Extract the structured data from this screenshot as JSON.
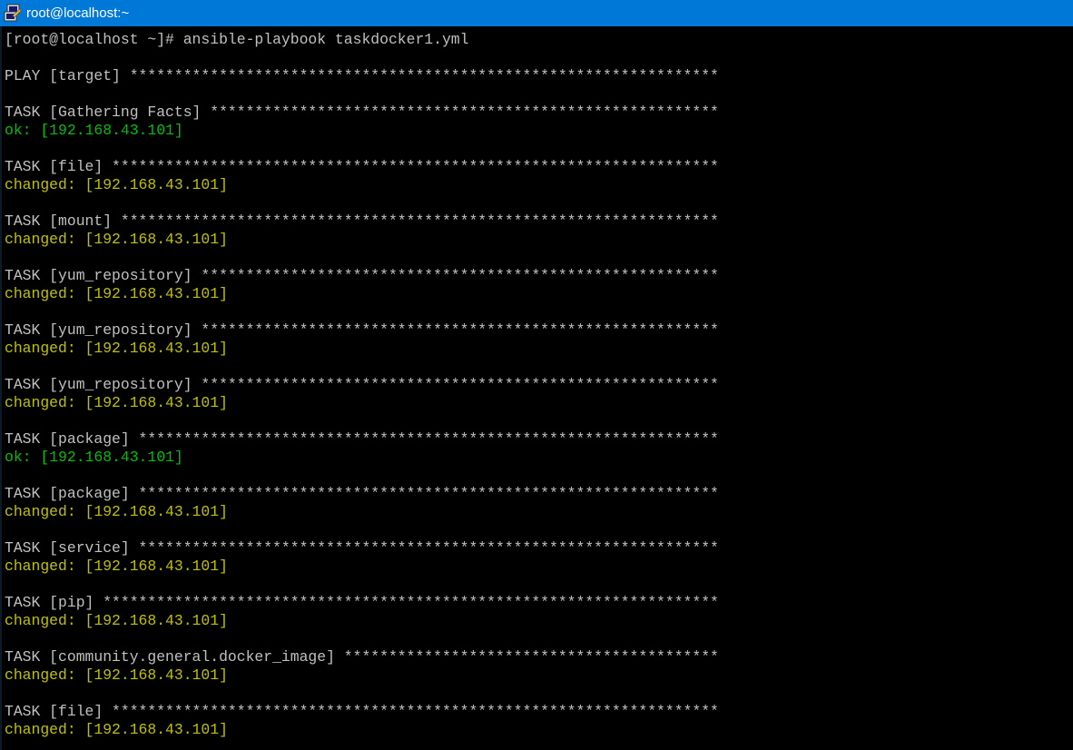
{
  "window": {
    "title": "root@localhost:~",
    "icon": "putty-icon"
  },
  "colors": {
    "titlebar": "#0078d7",
    "background": "#000000",
    "default_text": "#c0c0c0",
    "ok": "#00c000",
    "changed": "#c0c000"
  },
  "terminal": {
    "lines": [
      {
        "text": "[root@localhost ~]# ansible-playbook taskdocker1.yml",
        "style": "default"
      },
      {
        "text": "",
        "style": "default"
      },
      {
        "text": "PLAY [target] ******************************************************************",
        "style": "default"
      },
      {
        "text": "",
        "style": "default"
      },
      {
        "text": "TASK [Gathering Facts] *********************************************************",
        "style": "default"
      },
      {
        "text": "ok: [192.168.43.101]",
        "style": "green"
      },
      {
        "text": "",
        "style": "default"
      },
      {
        "text": "TASK [file] ********************************************************************",
        "style": "default"
      },
      {
        "text": "changed: [192.168.43.101]",
        "style": "yellow"
      },
      {
        "text": "",
        "style": "default"
      },
      {
        "text": "TASK [mount] *******************************************************************",
        "style": "default"
      },
      {
        "text": "changed: [192.168.43.101]",
        "style": "yellow"
      },
      {
        "text": "",
        "style": "default"
      },
      {
        "text": "TASK [yum_repository] **********************************************************",
        "style": "default"
      },
      {
        "text": "changed: [192.168.43.101]",
        "style": "yellow"
      },
      {
        "text": "",
        "style": "default"
      },
      {
        "text": "TASK [yum_repository] **********************************************************",
        "style": "default"
      },
      {
        "text": "changed: [192.168.43.101]",
        "style": "yellow"
      },
      {
        "text": "",
        "style": "default"
      },
      {
        "text": "TASK [yum_repository] **********************************************************",
        "style": "default"
      },
      {
        "text": "changed: [192.168.43.101]",
        "style": "yellow"
      },
      {
        "text": "",
        "style": "default"
      },
      {
        "text": "TASK [package] *****************************************************************",
        "style": "default"
      },
      {
        "text": "ok: [192.168.43.101]",
        "style": "green"
      },
      {
        "text": "",
        "style": "default"
      },
      {
        "text": "TASK [package] *****************************************************************",
        "style": "default"
      },
      {
        "text": "changed: [192.168.43.101]",
        "style": "yellow"
      },
      {
        "text": "",
        "style": "default"
      },
      {
        "text": "TASK [service] *****************************************************************",
        "style": "default"
      },
      {
        "text": "changed: [192.168.43.101]",
        "style": "yellow"
      },
      {
        "text": "",
        "style": "default"
      },
      {
        "text": "TASK [pip] *********************************************************************",
        "style": "default"
      },
      {
        "text": "changed: [192.168.43.101]",
        "style": "yellow"
      },
      {
        "text": "",
        "style": "default"
      },
      {
        "text": "TASK [community.general.docker_image] ******************************************",
        "style": "default"
      },
      {
        "text": "changed: [192.168.43.101]",
        "style": "yellow"
      },
      {
        "text": "",
        "style": "default"
      },
      {
        "text": "TASK [file] ********************************************************************",
        "style": "default"
      },
      {
        "text": "changed: [192.168.43.101]",
        "style": "yellow"
      }
    ]
  }
}
